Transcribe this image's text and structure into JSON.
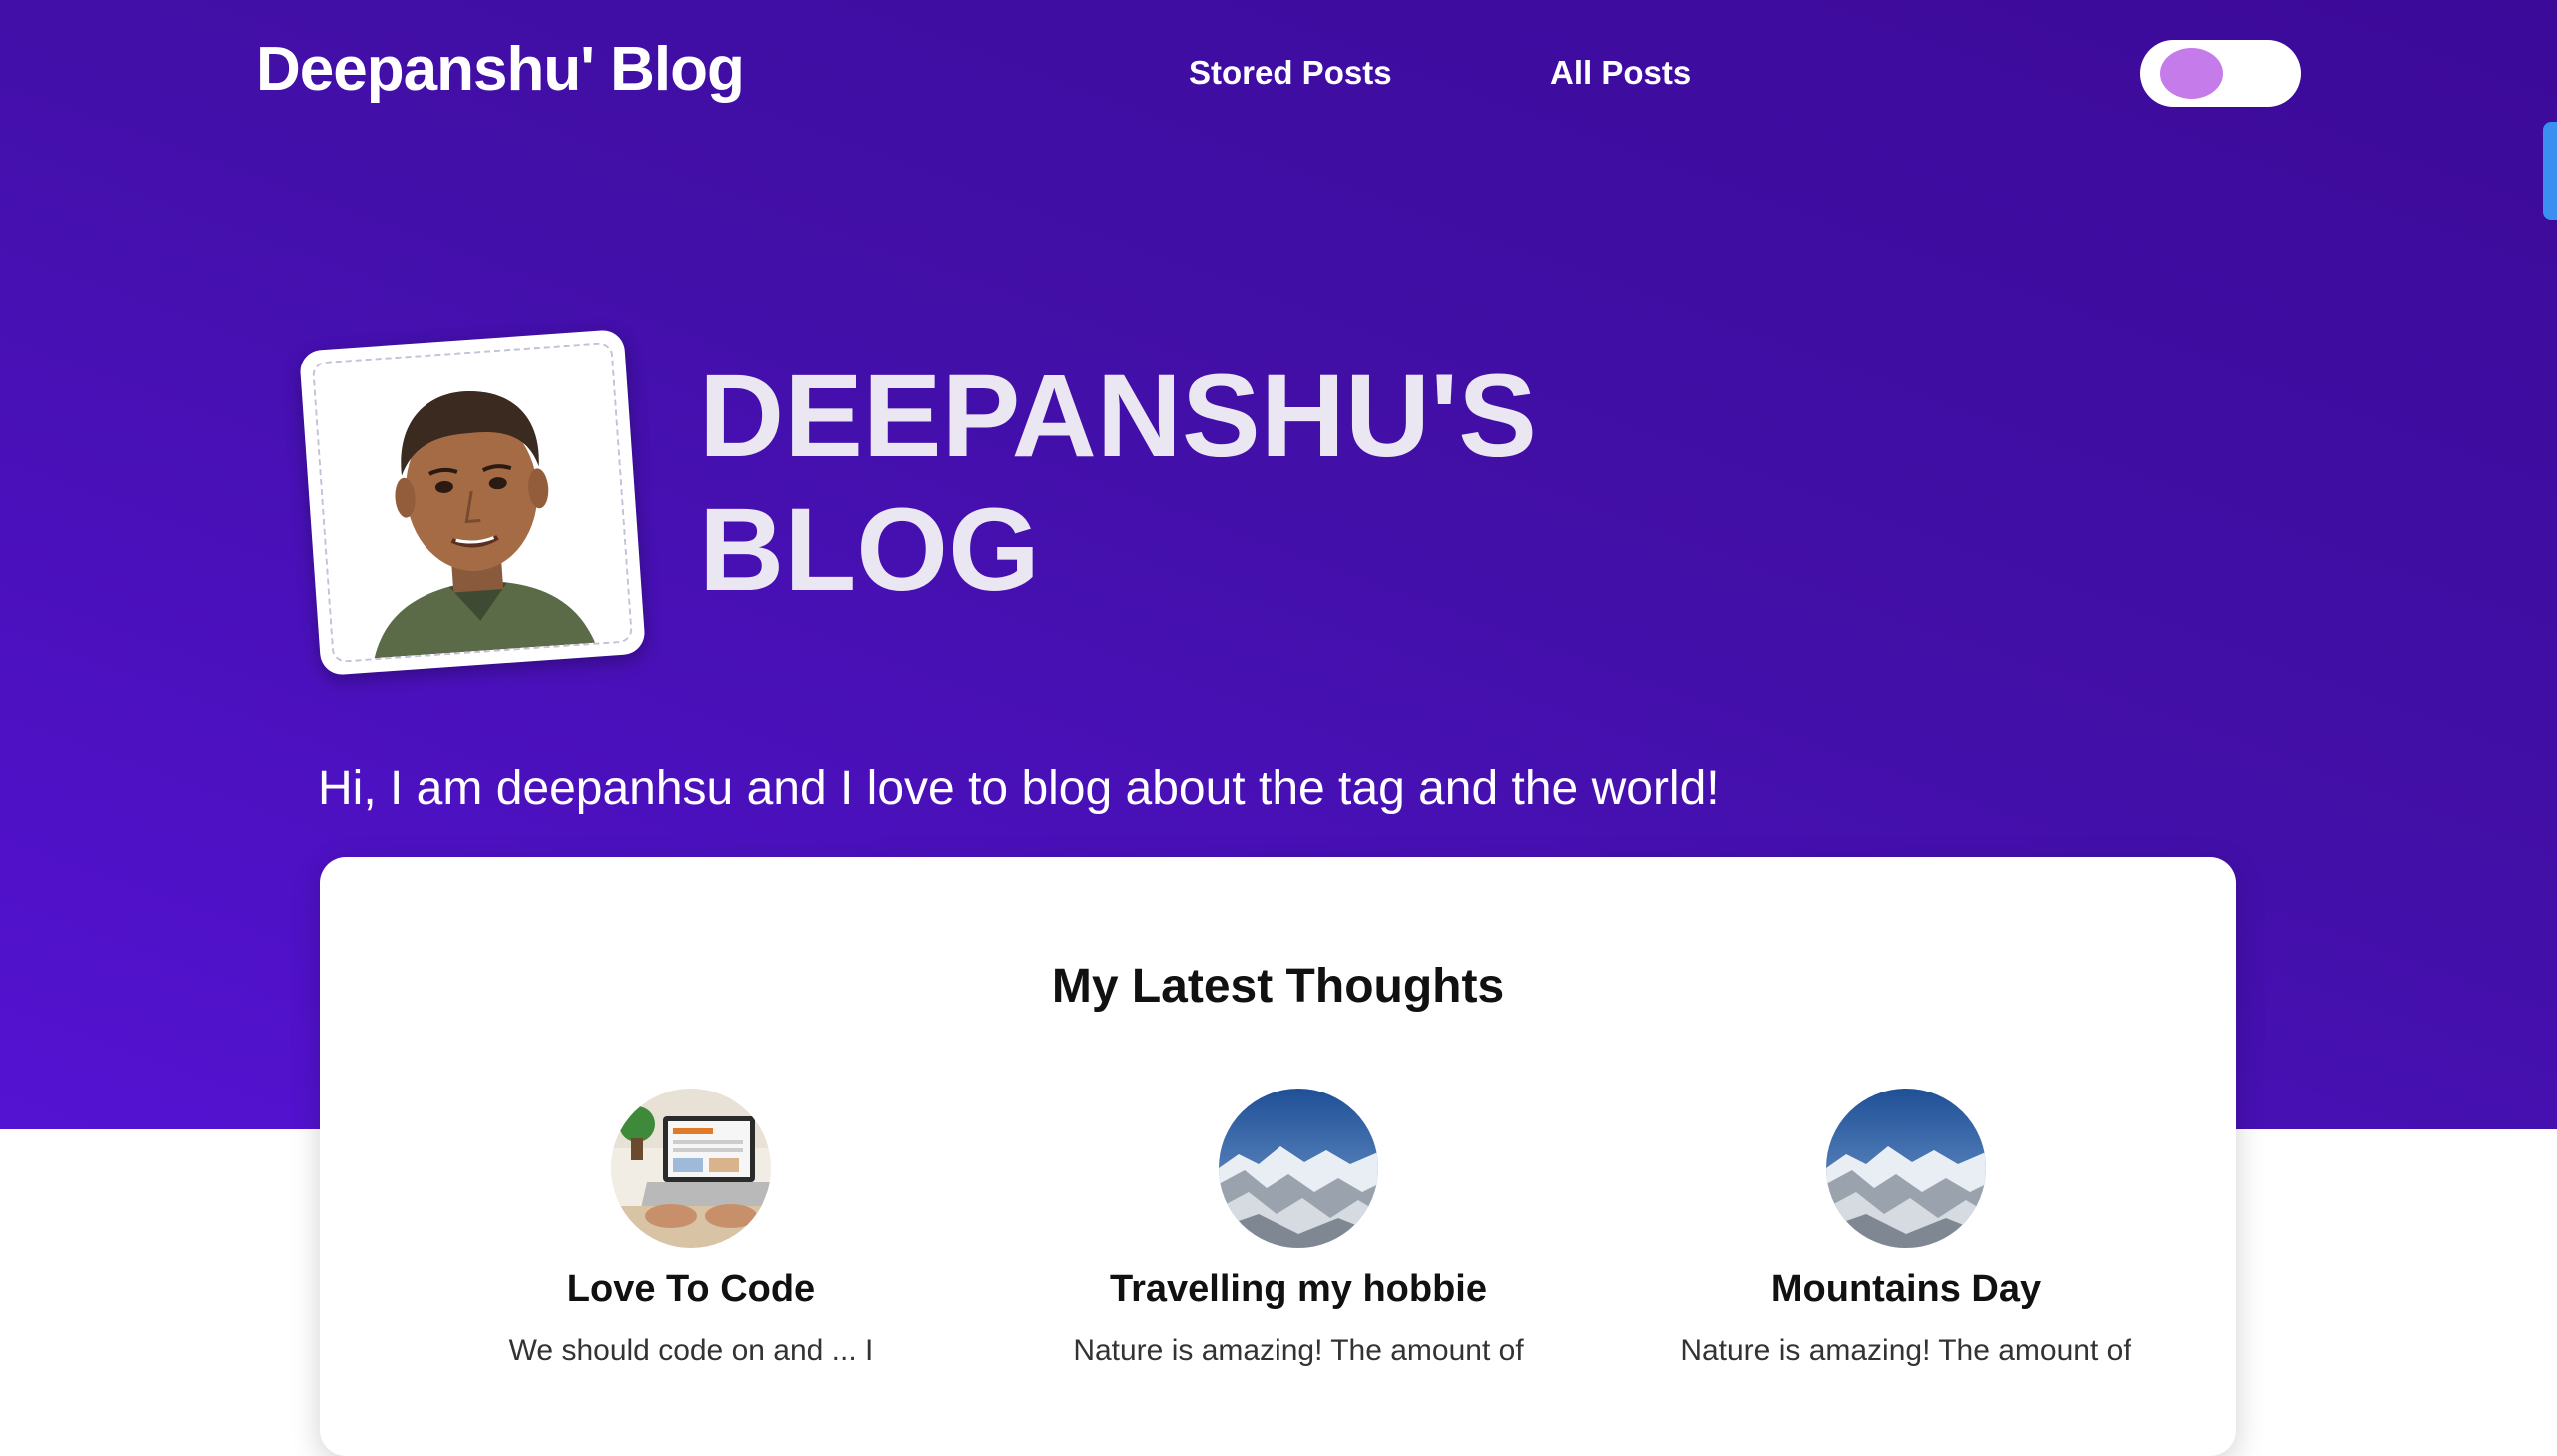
{
  "header": {
    "brand": "Deepanshu' Blog",
    "nav": [
      {
        "label": "Stored Posts"
      },
      {
        "label": "All Posts"
      }
    ],
    "theme_toggle": {
      "state": "off",
      "knob_color": "#c57be9"
    }
  },
  "hero": {
    "title_line1": "DEEPANSHU'S",
    "title_line2": "BLOG",
    "tagline": "Hi, I am deepanhsu and I love to blog about the tag and the world!",
    "gradient": [
      "#3c0a99",
      "#5412d2"
    ]
  },
  "latest": {
    "heading": "My Latest Thoughts",
    "posts": [
      {
        "title": "Love To Code",
        "excerpt": "We should code on and ... I",
        "thumb": "laptop-image"
      },
      {
        "title": "Travelling my hobbie",
        "excerpt": "Nature is amazing! The amount of",
        "thumb": "mountains-image"
      },
      {
        "title": "Mountains Day",
        "excerpt": "Nature is amazing! The amount of",
        "thumb": "mountains-image"
      }
    ]
  },
  "colors": {
    "accent": "#3a8ff0",
    "card_bg": "#ffffff",
    "text_on_hero": "#ffffff"
  }
}
